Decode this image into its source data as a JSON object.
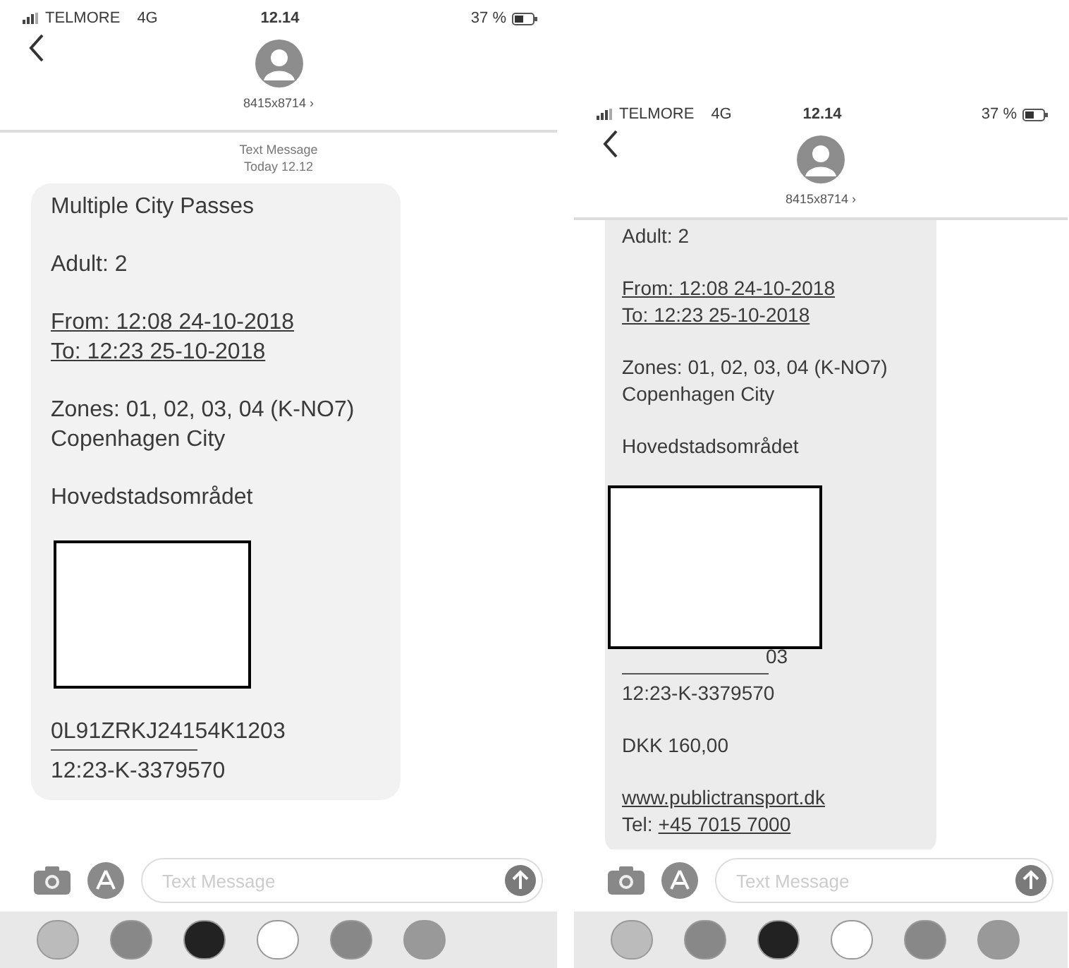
{
  "screens": [
    {
      "status": {
        "carrier": "TELMORE",
        "network": "4G",
        "time": "12.14",
        "battery": "37 %"
      },
      "contact": {
        "number": "8415x8714 ›"
      },
      "header": {
        "label": "Text Message",
        "date": "Today 12.12"
      },
      "message": {
        "blocks": [
          {
            "lines": [
              {
                "kind": "text",
                "text": "Multiple City Passes"
              }
            ]
          },
          {
            "lines": [
              {
                "kind": "text",
                "text": "Adult:  2"
              }
            ]
          },
          {
            "lines": [
              {
                "kind": "underlined",
                "text": "From: 12:08 24-10-2018"
              },
              {
                "kind": "underlined",
                "text": "To: 12:23 25-10-2018"
              }
            ]
          },
          {
            "lines": [
              {
                "kind": "text",
                "text": "Zones: 01, 02, 03, 04 (K-NO7)"
              },
              {
                "kind": "text",
                "text": "Copenhagen City"
              }
            ]
          },
          {
            "lines": [
              {
                "kind": "text",
                "text": "Hovedstadsområdet"
              }
            ]
          },
          {
            "lines": [
              {
                "kind": "redaction"
              }
            ]
          },
          {
            "lines": [
              {
                "kind": "text",
                "text": "0L91ZRKJ24154K1203"
              },
              {
                "kind": "rule"
              },
              {
                "kind": "text",
                "text": "12:23-K-3379570"
              }
            ]
          }
        ]
      },
      "input": {
        "placeholder": "Text Message"
      }
    },
    {
      "status": {
        "carrier": "TELMORE",
        "network": "4G",
        "time": "12.14",
        "battery": "37 %"
      },
      "contact": {
        "number": "8415x8714 ›"
      },
      "message": {
        "blocks": [
          {
            "lines": [
              {
                "kind": "text",
                "text": "Adult:  2"
              }
            ]
          },
          {
            "lines": [
              {
                "kind": "underlined",
                "text": "From: 12:08 24-10-2018"
              },
              {
                "kind": "underlined",
                "text": "To: 12:23 25-10-2018"
              }
            ]
          },
          {
            "lines": [
              {
                "kind": "text",
                "text": "Zones: 01, 02, 03, 04 (K-NO7)"
              },
              {
                "kind": "text",
                "text": "Copenhagen City"
              }
            ]
          },
          {
            "lines": [
              {
                "kind": "text",
                "text": "Hovedstadsområdet"
              }
            ]
          },
          {
            "lines": [
              {
                "kind": "redaction"
              },
              {
                "kind": "tail",
                "text": "03"
              },
              {
                "kind": "rule"
              },
              {
                "kind": "text",
                "text": "12:23-K-3379570"
              }
            ]
          },
          {
            "lines": [
              {
                "kind": "text",
                "text": "DKK 160,00"
              }
            ]
          },
          {
            "lines": [
              {
                "kind": "link",
                "text": "www.publictransport.dk"
              },
              {
                "kind": "tel",
                "label": "Tel:",
                "link": "+45 7015 7000"
              }
            ]
          }
        ]
      },
      "input": {
        "placeholder": "Text Message"
      }
    }
  ]
}
